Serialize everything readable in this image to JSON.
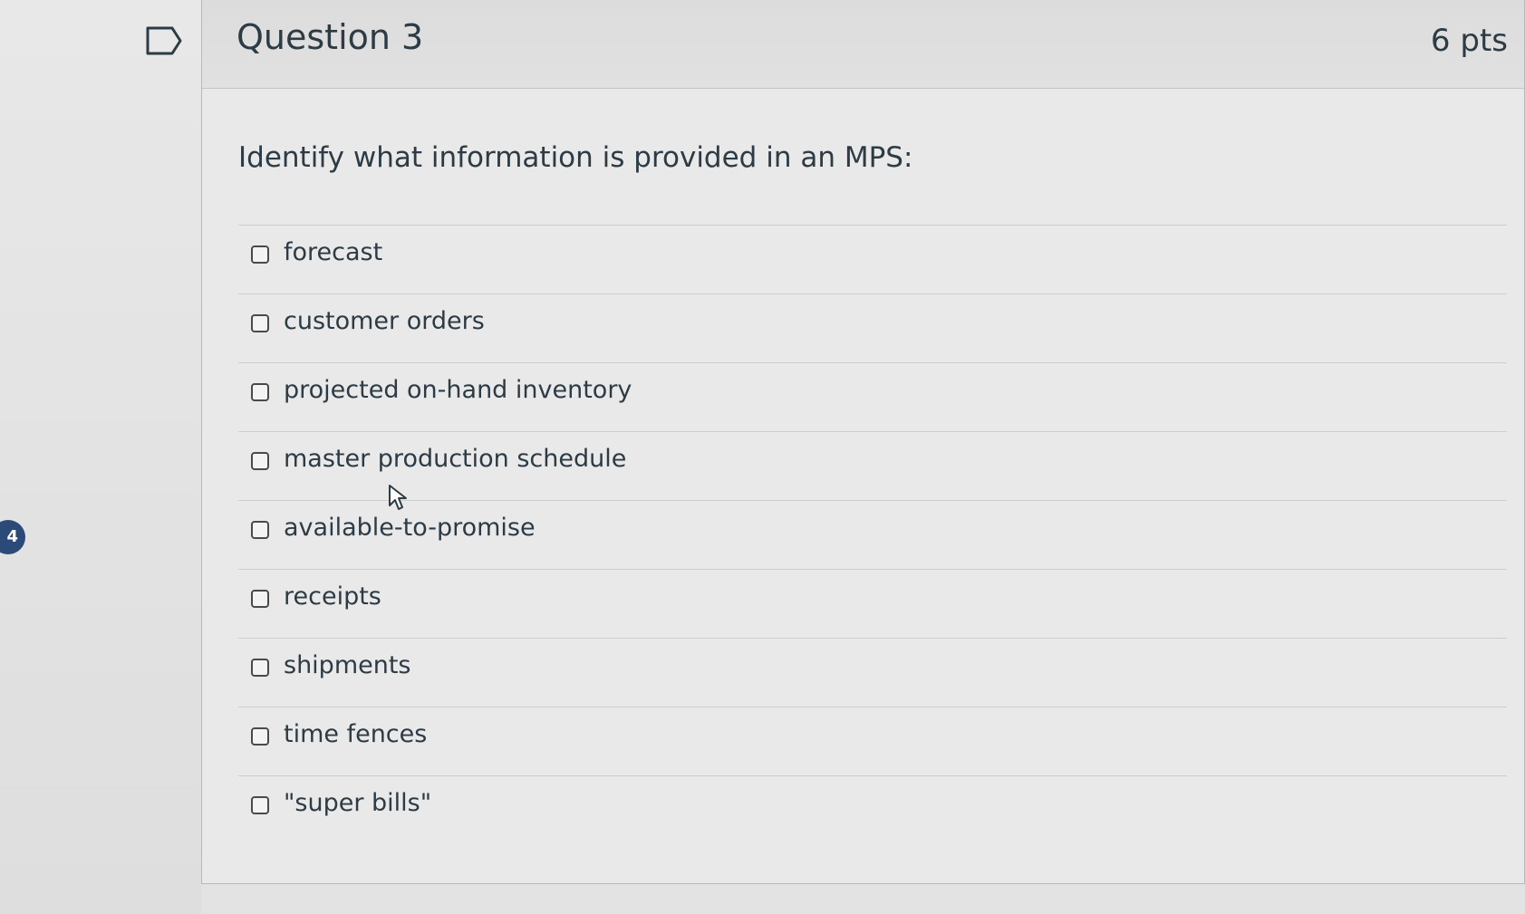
{
  "question": {
    "title": "Question 3",
    "points": "6 pts",
    "prompt": "Identify what information is provided in an MPS:",
    "answers": [
      {
        "label": "forecast",
        "checked": false
      },
      {
        "label": "customer orders",
        "checked": false
      },
      {
        "label": "projected on-hand inventory",
        "checked": false
      },
      {
        "label": "master production schedule",
        "checked": false
      },
      {
        "label": "available-to-promise",
        "checked": false
      },
      {
        "label": "receipts",
        "checked": false
      },
      {
        "label": "shipments",
        "checked": false
      },
      {
        "label": "time fences",
        "checked": false
      },
      {
        "label": "\"super bills\"",
        "checked": false
      }
    ]
  },
  "nav": {
    "badge_number": "4"
  },
  "icons": {
    "flag": "flag-outline-icon",
    "cursor": "mouse-pointer-icon"
  },
  "colors": {
    "text": "#2d3b45",
    "badge": "#2b4a7a"
  }
}
